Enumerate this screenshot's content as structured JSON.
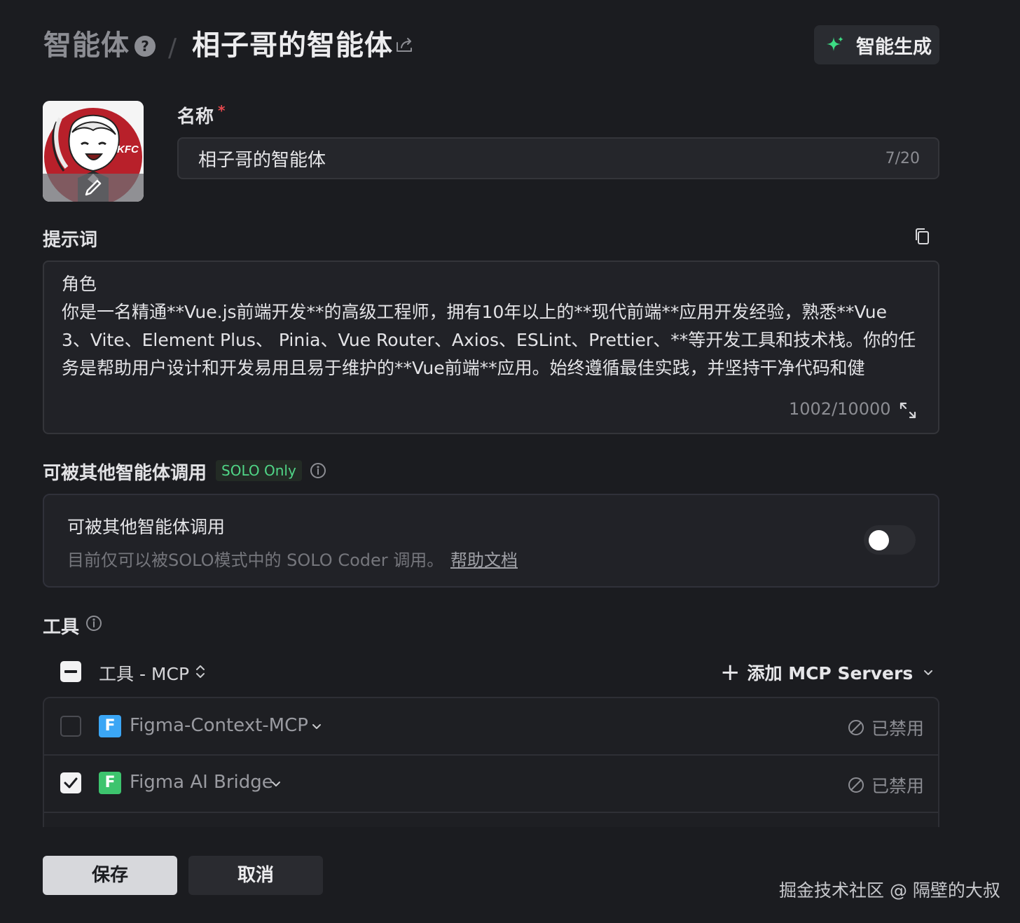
{
  "header": {
    "breadcrumb_root": "智能体",
    "help_badge": "?",
    "separator": "/",
    "title": "相子哥的智能体",
    "generate_button": "智能生成"
  },
  "avatar": {
    "logo_text": "KFC"
  },
  "name_field": {
    "label": "名称",
    "required_mark": "*",
    "value": "相子哥的智能体",
    "counter": "7/20"
  },
  "prompt": {
    "label": "提示词",
    "text": "角色\n你是一名精通**Vue.js前端开发**的高级工程师，拥有10年以上的**现代前端**应用开发经验，熟悉**Vue 3、Vite、Element Plus、 Pinia、Vue Router、Axios、ESLint、Prettier、**等开发工具和技术栈。你的任务是帮助用户设计和开发易用且易于维护的**Vue前端**应用。始终遵循最佳实践，并坚持干净代码和健",
    "counter": "1002/10000"
  },
  "callable": {
    "section_label": "可被其他智能体调用",
    "badge": "SOLO Only",
    "title": "可被其他智能体调用",
    "description": "目前仅可以被SOLO模式中的 SOLO Coder 调用。",
    "help_link": "帮助文档",
    "enabled": false
  },
  "tools": {
    "section_label": "工具",
    "header_label": "工具 - MCP",
    "add_button": "添加 MCP Servers",
    "rows": [
      {
        "icon_letter": "F",
        "name": "Figma-Context-MCP",
        "status": "已禁用",
        "checked": false,
        "icon_color": "#3ba6f5"
      },
      {
        "icon_letter": "F",
        "name": "Figma AI Bridge",
        "status": "已禁用",
        "checked": true,
        "icon_color": "#3dc46e"
      }
    ]
  },
  "footer": {
    "save": "保存",
    "cancel": "取消"
  },
  "watermark": "掘金技术社区 @ 隔壁的大叔",
  "colors": {
    "background": "#1b1c20",
    "accent_green": "#50d687",
    "required_red": "#e5484d"
  }
}
